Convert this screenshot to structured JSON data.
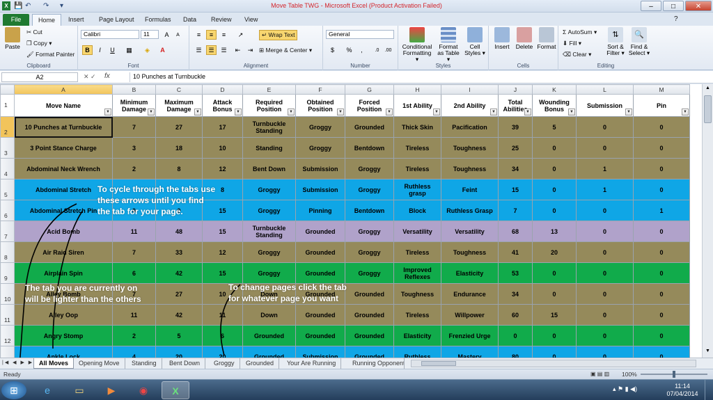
{
  "window": {
    "title": "Move Table TWG  -  Microsoft Excel (Product Activation Failed)"
  },
  "ribbon_tabs": [
    "File",
    "Home",
    "Insert",
    "Page Layout",
    "Formulas",
    "Data",
    "Review",
    "View"
  ],
  "ribbon": {
    "clipboard": {
      "paste": "Paste",
      "cut": "Cut",
      "copy": "Copy ▾",
      "format_painter": "Format Painter",
      "label": "Clipboard"
    },
    "font": {
      "name": "Calibri",
      "size": "11",
      "bold": "B",
      "italic": "I",
      "underline": "U",
      "label": "Font"
    },
    "alignment": {
      "wrap": "Wrap Text",
      "merge": "Merge & Center ▾",
      "label": "Alignment"
    },
    "number": {
      "format": "General",
      "percent": "%",
      "comma": ",",
      "label": "Number"
    },
    "styles": {
      "cond": "Conditional Formatting ▾",
      "table": "Format as Table ▾",
      "cell": "Cell Styles ▾",
      "label": "Styles"
    },
    "cells": {
      "insert": "Insert",
      "delete": "Delete",
      "format": "Format",
      "label": "Cells"
    },
    "editing": {
      "autosum": "Σ AutoSum ▾",
      "fill": "Fill ▾",
      "clear": "Clear ▾",
      "sort": "Sort & Filter ▾",
      "find": "Find & Select ▾",
      "label": "Editing"
    }
  },
  "formula_bar": {
    "name_box": "A2",
    "fx": "fx",
    "value": "10 Punches at Turnbuckle"
  },
  "columns": [
    "A",
    "B",
    "C",
    "D",
    "E",
    "F",
    "G",
    "H",
    "I",
    "J",
    "K",
    "L",
    "M"
  ],
  "headers": [
    "Move Name",
    "Minimum Damage",
    "Maximum Damage",
    "Attack Bonus",
    "Required Position",
    "Obtained Position",
    "Forced Position",
    "1st Ability",
    "2nd Ability",
    "Total Abilities",
    "Wounding Bonus",
    "Submission",
    "Pin"
  ],
  "rows": [
    {
      "n": "2",
      "color": "olive",
      "cells": [
        "10 Punches at Turnbuckle",
        "7",
        "27",
        "17",
        "Turnbuckle Standing",
        "Groggy",
        "Grounded",
        "Thick Skin",
        "Pacification",
        "39",
        "5",
        "0",
        "0"
      ]
    },
    {
      "n": "3",
      "color": "olive",
      "cells": [
        "3 Point Stance Charge",
        "3",
        "18",
        "10",
        "Standing",
        "Groggy",
        "Bentdown",
        "Tireless",
        "Toughness",
        "25",
        "0",
        "0",
        "0"
      ]
    },
    {
      "n": "4",
      "color": "olive",
      "cells": [
        "Abdominal Neck Wrench",
        "2",
        "8",
        "12",
        "Bent Down",
        "Submission",
        "Groggy",
        "Tireless",
        "Toughness",
        "34",
        "0",
        "1",
        "0"
      ]
    },
    {
      "n": "5",
      "color": "blue",
      "cells": [
        "Abdominal Stretch",
        "",
        "",
        "8",
        "Groggy",
        "Submission",
        "Groggy",
        "Ruthless grasp",
        "Feint",
        "15",
        "0",
        "1",
        "0"
      ]
    },
    {
      "n": "6",
      "color": "blue",
      "cells": [
        "Abdominal Stretch Pin",
        "0",
        "0",
        "15",
        "Groggy",
        "Pinning",
        "Bentdown",
        "Block",
        "Ruthless Grasp",
        "7",
        "0",
        "0",
        "1"
      ]
    },
    {
      "n": "7",
      "color": "purple",
      "cells": [
        "Acid Bomb",
        "11",
        "48",
        "15",
        "Turnbuckle Standing",
        "Grounded",
        "Groggy",
        "Versatility",
        "Versatility",
        "68",
        "13",
        "0",
        "0"
      ]
    },
    {
      "n": "8",
      "color": "olive",
      "cells": [
        "Air Raid Siren",
        "7",
        "33",
        "12",
        "Groggy",
        "Grounded",
        "Groggy",
        "Tireless",
        "Toughness",
        "41",
        "20",
        "0",
        "0"
      ]
    },
    {
      "n": "9",
      "color": "green",
      "cells": [
        "Airplain Spin",
        "6",
        "42",
        "15",
        "Groggy",
        "Grounded",
        "Groggy",
        "Improved Reflexes",
        "Elasticity",
        "53",
        "0",
        "0",
        "0"
      ]
    },
    {
      "n": "10",
      "color": "olive",
      "cells": [
        "Alley Bomb",
        "7",
        "27",
        "10",
        "Down",
        "Grounded",
        "Grounded",
        "Toughness",
        "Endurance",
        "34",
        "0",
        "0",
        "0"
      ]
    },
    {
      "n": "11",
      "color": "olive",
      "cells": [
        "Alley Oop",
        "11",
        "42",
        "11",
        "Down",
        "Grounded",
        "Grounded",
        "Tireless",
        "Willpower",
        "60",
        "15",
        "0",
        "0"
      ]
    },
    {
      "n": "12",
      "color": "green",
      "cells": [
        "Angry Stomp",
        "2",
        "5",
        "6",
        "Grounded",
        "Grounded",
        "Grounded",
        "Elasticity",
        "Frenzied Urge",
        "0",
        "0",
        "0",
        "0"
      ]
    },
    {
      "n": "13",
      "color": "blue",
      "cells": [
        "Ankle Lock",
        "4",
        "20",
        "20",
        "Grounded",
        "Submission",
        "Grounded",
        "Ruthless",
        "Mastery",
        "80",
        "0",
        "0",
        "0"
      ]
    }
  ],
  "annotations": [
    "To cycle through the tabs use these arrows until you find the tab for your page.",
    "The tab you are currently on will be lighter than the others",
    "To change pages click the tab for whatever page you want"
  ],
  "sheet_tabs": [
    "All Moves",
    "Opening Move",
    "Standing",
    "Bent Down",
    "Groggy",
    "Grounded",
    "Your Are Running",
    "Running Opponent"
  ],
  "status": {
    "ready": "Ready",
    "zoom": "100%"
  },
  "taskbar": {
    "time": "11:14",
    "date": "07/04/2014"
  },
  "colors": {
    "olive": "#958a5b",
    "blue": "#0fa6e6",
    "purple": "#b0a2ca",
    "green": "#11ab4b",
    "annotation_ink": "#000000"
  }
}
